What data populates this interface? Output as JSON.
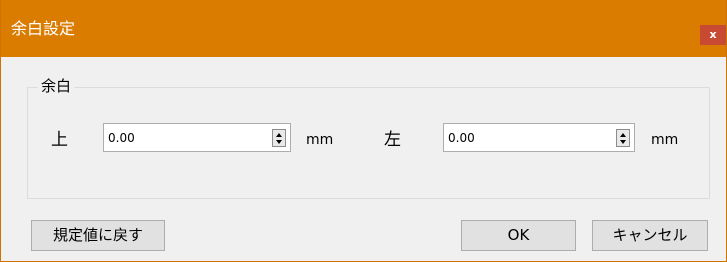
{
  "window": {
    "title": "余白設定",
    "close_label": "x"
  },
  "margin_group": {
    "label": "余白",
    "top": {
      "label": "上",
      "value": "0.00",
      "unit": "mm"
    },
    "left": {
      "label": "左",
      "value": "0.00",
      "unit": "mm"
    }
  },
  "buttons": {
    "reset_label": "規定値に戻す",
    "ok_label": "OK",
    "cancel_label": "キャンセル"
  },
  "colors": {
    "titlebar": "#da7c00",
    "close_button": "#c94a32",
    "dialog_background": "#f0f0f0"
  }
}
